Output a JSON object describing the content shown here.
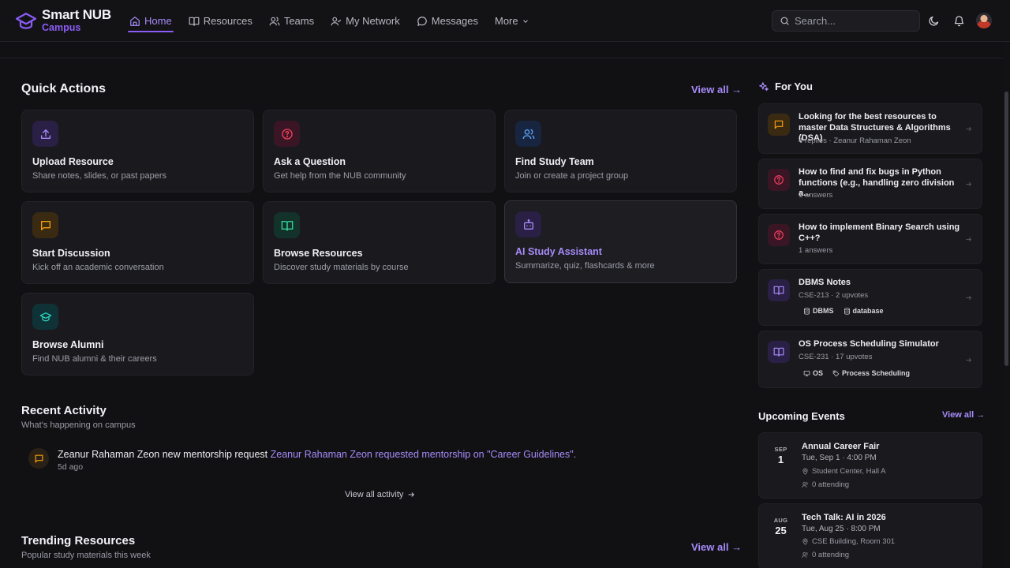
{
  "brand": {
    "name": "Smart NUB",
    "sub": "Campus"
  },
  "nav": {
    "home": "Home",
    "resources": "Resources",
    "teams": "Teams",
    "network": "My Network",
    "messages": "Messages",
    "more": "More"
  },
  "search": {
    "placeholder": "Search..."
  },
  "colors": {
    "accent": "#8b5cf6",
    "background": "#111114",
    "card": "#1a1a1e"
  },
  "quick_actions": {
    "title": "Quick Actions",
    "view_all": "View all →",
    "items": [
      {
        "icon": "upload-icon",
        "title": "Upload Resource",
        "desc": "Share notes, slides, or past papers"
      },
      {
        "icon": "question-icon",
        "title": "Ask a Question",
        "desc": "Get help from the NUB community"
      },
      {
        "icon": "users-icon",
        "title": "Find Study Team",
        "desc": "Join or create a project group"
      },
      {
        "icon": "chat-icon",
        "title": "Start Discussion",
        "desc": "Kick off an academic conversation"
      },
      {
        "icon": "book-icon",
        "title": "Browse Resources",
        "desc": "Discover study materials by course"
      },
      {
        "icon": "bot-icon",
        "title": "AI Study Assistant",
        "desc": "Summarize, quiz, flashcards & more"
      },
      {
        "icon": "graduation-cap-icon",
        "title": "Browse Alumni",
        "desc": "Find NUB alumni & their careers"
      }
    ]
  },
  "recent_activity": {
    "title": "Recent Activity",
    "subtitle": "What's happening on campus",
    "items": [
      {
        "actor": "Zeanur Rahaman Zeon",
        "action": " new mentorship request ",
        "link": "Zeanur Rahaman Zeon requested mentorship on \"Career Guidelines\".",
        "time": "5d ago"
      }
    ],
    "view_all": "View all activity"
  },
  "trending": {
    "title": "Trending Resources",
    "subtitle": "Popular study materials this week",
    "view_all": "View all →"
  },
  "for_you": {
    "title": "For You",
    "items": [
      {
        "icon": "chat-icon",
        "title": "Looking for the best resources to master Data Structures & Algorithms (DSA)",
        "meta": "4 replies · Zeanur Rahaman Zeon"
      },
      {
        "icon": "question-icon",
        "title": "How to find and fix bugs in Python functions (e.g., handling zero division a...",
        "meta": "1 answers"
      },
      {
        "icon": "question-icon",
        "title": "How to implement Binary Search using C++?",
        "meta": "1 answers"
      },
      {
        "icon": "book-icon",
        "title": "DBMS Notes",
        "meta": "CSE-213 · 2 upvotes",
        "tags": [
          "DBMS",
          "database"
        ]
      },
      {
        "icon": "book-icon",
        "title": "OS Process Scheduling Simulator",
        "meta": "CSE-231 · 17 upvotes",
        "tags": [
          "OS",
          "Process Scheduling"
        ]
      }
    ]
  },
  "events": {
    "title": "Upcoming Events",
    "view_all": "View all →",
    "items": [
      {
        "month": "SEP",
        "day": "1",
        "title": "Annual Career Fair",
        "time": "Tue, Sep 1 · 4:00 PM",
        "location": "Student Center, Hall A",
        "attending": "0 attending"
      },
      {
        "month": "AUG",
        "day": "25",
        "title": "Tech Talk: AI in 2026",
        "time": "Tue, Aug 25 · 8:00 PM",
        "location": "CSE Building, Room 301",
        "attending": "0 attending"
      }
    ]
  }
}
